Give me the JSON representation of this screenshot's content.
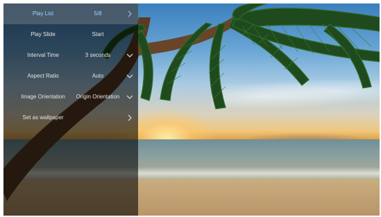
{
  "menu": {
    "items": [
      {
        "label": "Play List",
        "value": "5/8",
        "icon": "chevron-right-icon",
        "selected": true
      },
      {
        "label": "Play Slide",
        "value": "Start",
        "icon": "",
        "selected": false
      },
      {
        "label": "Interval Time",
        "value": "3 seconds",
        "icon": "chevron-down-icon",
        "selected": false
      },
      {
        "label": "Aspect Ratio",
        "value": "Auto",
        "icon": "chevron-down-icon",
        "selected": false
      },
      {
        "label": "Image Orientation",
        "value": "Origin Orientation",
        "icon": "chevron-down-icon",
        "selected": false
      },
      {
        "label": "Set as wallpaper",
        "value": "",
        "icon": "chevron-right-icon",
        "selected": false
      }
    ]
  },
  "colors": {
    "selected_text": "#9fd3ff",
    "panel_overlay": "rgba(0,0,0,0.58)",
    "selected_row_bg": "rgba(110,120,130,0.55)"
  }
}
